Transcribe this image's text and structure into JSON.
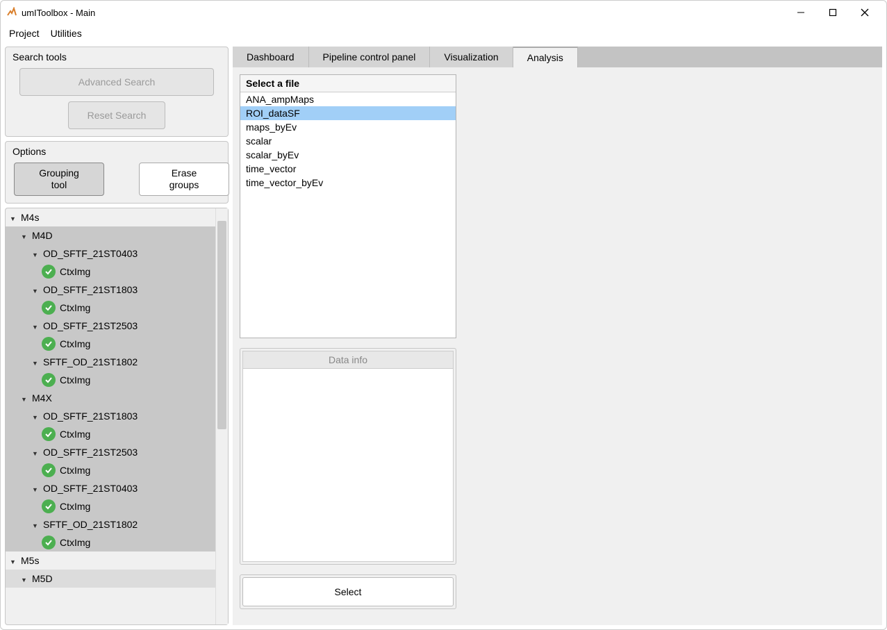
{
  "window": {
    "title": "umIToolbox - Main"
  },
  "menubar": {
    "project": "Project",
    "utilities": "Utilities"
  },
  "search": {
    "panel_title": "Search tools",
    "advanced": "Advanced Search",
    "reset": "Reset Search"
  },
  "options": {
    "panel_title": "Options",
    "grouping": "Grouping\ntool",
    "erase": "Erase\ngroups"
  },
  "tree": {
    "m4s": "M4s",
    "m4d": "M4D",
    "od0403": "OD_SFTF_21ST0403",
    "od1803": "OD_SFTF_21ST1803",
    "od2503": "OD_SFTF_21ST2503",
    "sftf1802": "SFTF_OD_21ST1802",
    "m4x": "M4X",
    "ctximg": "CtxImg",
    "m5s": "M5s",
    "m5d": "M5D"
  },
  "tabs": {
    "dashboard": "Dashboard",
    "pipeline": "Pipeline control panel",
    "visualization": "Visualization",
    "analysis": "Analysis"
  },
  "filebox": {
    "header": "Select a file",
    "items": [
      "ANA_ampMaps",
      "ROI_dataSF",
      "maps_byEv",
      "scalar",
      "scalar_byEv",
      "time_vector",
      "time_vector_byEv"
    ],
    "selected_index": 1
  },
  "info": {
    "header": "Data info"
  },
  "select_button": "Select"
}
